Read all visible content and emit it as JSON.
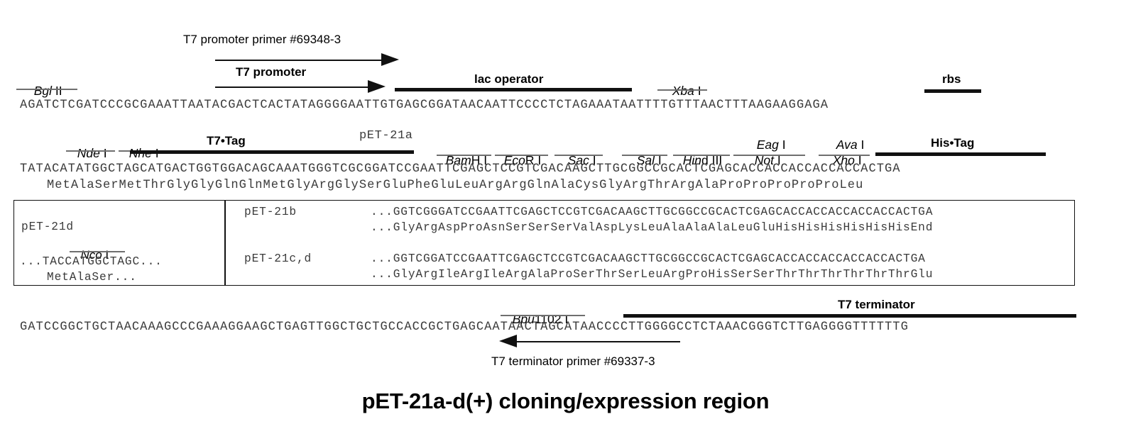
{
  "figure": {
    "title": "pET-21a-d(+) cloning/expression region"
  },
  "primers": {
    "forward": {
      "label": "T7 promoter primer #69348-3",
      "direction": "right"
    },
    "reverse": {
      "label": "T7 terminator primer #69337-3",
      "direction": "left"
    }
  },
  "features": {
    "t7_promoter": "T7 promoter",
    "lac_operator": "lac operator",
    "rbs": "rbs",
    "t7_tag": "T7•Tag",
    "his_tag": "His•Tag",
    "t7_terminator": "T7 terminator",
    "plasmid_marker": "pET-21a"
  },
  "enzymes": {
    "bgl2": {
      "italic": "Bgl",
      "roman": " II"
    },
    "xba": {
      "italic": "Xba",
      "roman": " I"
    },
    "nde": {
      "italic": "Nde",
      "roman": " I"
    },
    "nhe": {
      "italic": "Nhe",
      "roman": " I"
    },
    "bamh": {
      "italic": "Bam",
      "roman": "H I"
    },
    "ecor": {
      "italic": "Eco",
      "roman": "R I"
    },
    "sac": {
      "italic": "Sac",
      "roman": " I"
    },
    "sal": {
      "italic": "Sal",
      "roman": " I"
    },
    "hind": {
      "italic": "Hin",
      "roman": "d III"
    },
    "eag": {
      "italic": "Eag",
      "roman": " I"
    },
    "not": {
      "italic": "Not",
      "roman": " I"
    },
    "ava": {
      "italic": "Ava",
      "roman": " I"
    },
    "xho": {
      "italic": "Xho",
      "roman": " I"
    },
    "nco": {
      "italic": "Nco",
      "roman": " I"
    },
    "bpu1102": {
      "italic": "Bpu",
      "roman": "1102 I"
    }
  },
  "sequences": {
    "line1_dna": "AGATCTCGATCCCGCGAAATTAATACGACTCACTATAGGGGAATTGTGAGCGGATAACAATTCCCCTCTAGAAATAATTTTGTTTAACTTTAAGAAGGAGA",
    "line2_dna": "TATACATATGGCTAGCATGACTGGTGGACAGCAAATGGGTCGCGGATCCGAATTCGAGCTCCGTCGACAAGCTTGCGGCCGCACTCGAGCACCACCACCACCACCACTGA",
    "line2_protein": "MetAlaSerMetThrGlyGlyGlnGlnMetGlyArgGlySerGluPheGluLeuArgArgGlnAlaCysGlyArgThrArgAlaProProProProProLeu",
    "line3_dna": "GATCCGGCTGCTAACAAAGCCCGAAAGGAAGCTGAGTTGGCTGCTGCCACCGCTGAGCAATAACTAGCATAACCCCTTGGGGCCTCTAAACGGGTCTTGAGGGGTTTTTTG"
  },
  "variants": {
    "left": {
      "name": "pET-21d",
      "dna": "...TACCATGGCTAGC...",
      "protein": "MetAlaSer..."
    },
    "rows": [
      {
        "name": "pET-21b",
        "dna": "...GGTCGGGATCCGAATTCGAGCTCCGTCGACAAGCTTGCGGCCGCACTCGAGCACCACCACCACCACCACTGA",
        "protein": "...GlyArgAspProAsnSerSerSerValAspLysLeuAlaAlaAlaLeuGluHisHisHisHisHisHisEnd"
      },
      {
        "name": "pET-21c,d",
        "dna": "...GGTCGGATCCGAATTCGAGCTCCGTCGACAAGCTTGCGGCCGCACTCGAGCACCACCACCACCACCACTGA",
        "protein": "...GlyArgIleArgIleArgAlaProSerThrSerLeuArgProHisSerSerThrThrThrThrThrThrGlu"
      }
    ]
  }
}
